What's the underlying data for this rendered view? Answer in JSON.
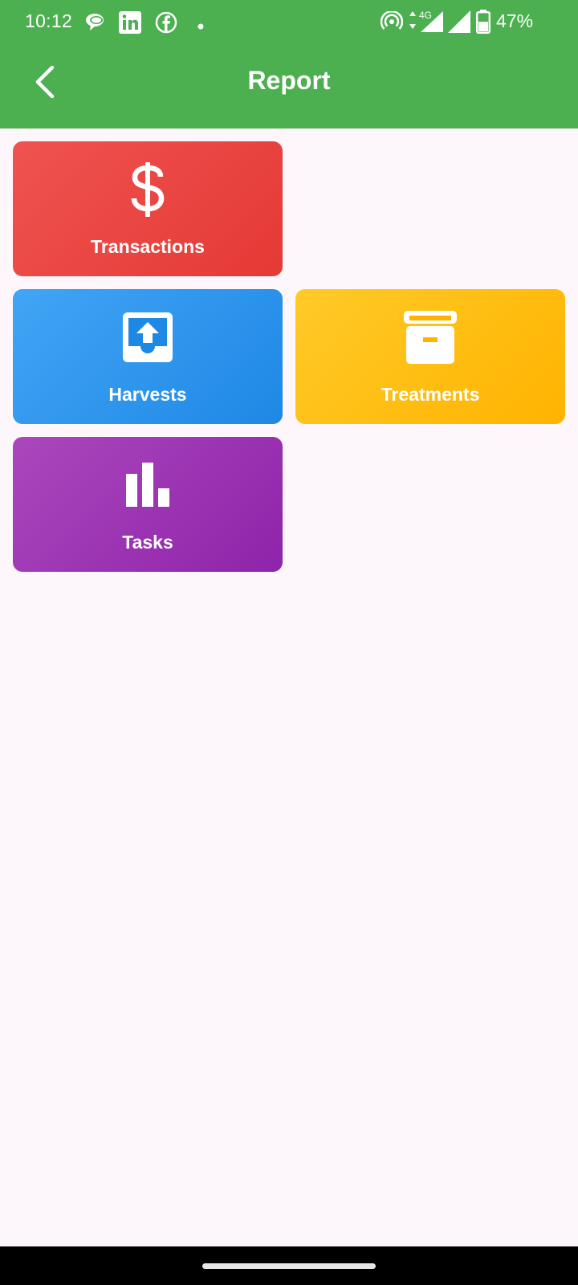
{
  "status_bar": {
    "time": "10:12",
    "notification_icons": [
      "chat-bubbles-icon",
      "linkedin-icon",
      "facebook-icon",
      "dot-icon"
    ],
    "system_icons": [
      "hotspot-icon",
      "network-4g-icon",
      "signal-icon",
      "signal-icon",
      "battery-icon"
    ],
    "network_label": "4G",
    "battery": "47%"
  },
  "header": {
    "title": "Report",
    "back_icon": "chevron-left-icon",
    "background": "#4caf50"
  },
  "tiles": [
    {
      "label": "Transactions",
      "icon": "dollar-icon",
      "color": "#e53935"
    },
    {
      "label": "Harvests",
      "icon": "inbox-upload-icon",
      "color": "#1e88e5"
    },
    {
      "label": "Treatments",
      "icon": "archive-box-icon",
      "color": "#ffb300"
    },
    {
      "label": "Tasks",
      "icon": "bar-chart-icon",
      "color": "#8e24aa"
    }
  ],
  "theme": {
    "page_background": "#fdf7fc",
    "nav_bar": "#000000"
  }
}
